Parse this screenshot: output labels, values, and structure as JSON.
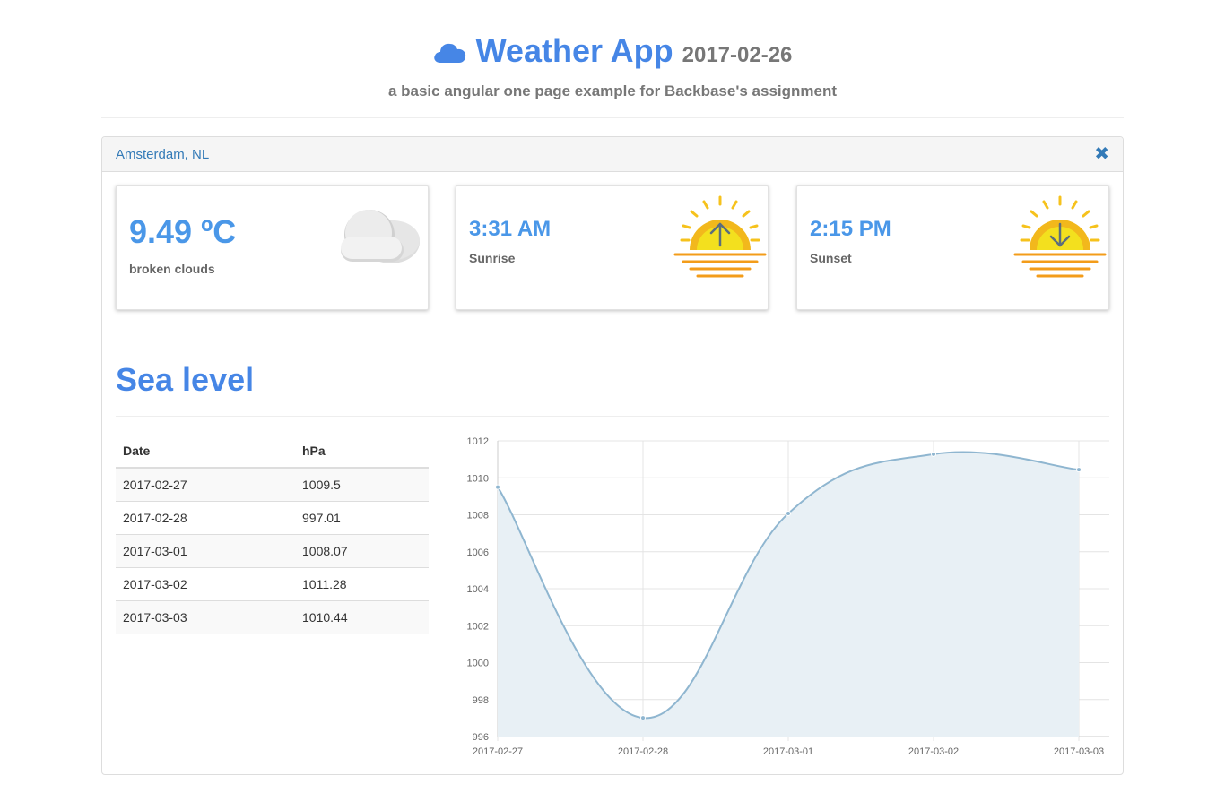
{
  "header": {
    "title": "Weather App",
    "date": "2017-02-26",
    "subtitle": "a basic angular one page example for Backbase's assignment",
    "logo_icon": "cloud-icon"
  },
  "panel": {
    "city": "Amsterdam, NL",
    "close_label": "✖"
  },
  "cards": {
    "temperature": {
      "value": "9.49 ºC",
      "label": "broken clouds",
      "icon": "cloud-icon"
    },
    "sunrise": {
      "value": "3:31 AM",
      "label": "Sunrise",
      "icon": "sunrise-icon"
    },
    "sunset": {
      "value": "2:15 PM",
      "label": "Sunset",
      "icon": "sunset-icon"
    }
  },
  "section": {
    "title": "Sea level"
  },
  "table": {
    "headers": [
      "Date",
      "hPa"
    ],
    "rows": [
      [
        "2017-02-27",
        "1009.5"
      ],
      [
        "2017-02-28",
        "997.01"
      ],
      [
        "2017-03-01",
        "1008.07"
      ],
      [
        "2017-03-02",
        "1011.28"
      ],
      [
        "2017-03-03",
        "1010.44"
      ]
    ]
  },
  "colors": {
    "accent": "#4686e6",
    "value_blue": "#4a97e8",
    "line": "#8fb6d0",
    "area": "#e8f0f5"
  },
  "chart_data": {
    "type": "area",
    "x": [
      "2017-02-27",
      "2017-02-28",
      "2017-03-01",
      "2017-03-02",
      "2017-03-03"
    ],
    "series": [
      {
        "values": [
          1009.5,
          997.01,
          1008.07,
          1011.28,
          1010.44
        ]
      }
    ],
    "ylim": [
      996,
      1012
    ],
    "yticks": [
      996,
      998,
      1000,
      1002,
      1004,
      1006,
      1008,
      1010,
      1012
    ],
    "grid": true,
    "title": "",
    "xlabel": "",
    "ylabel": ""
  }
}
